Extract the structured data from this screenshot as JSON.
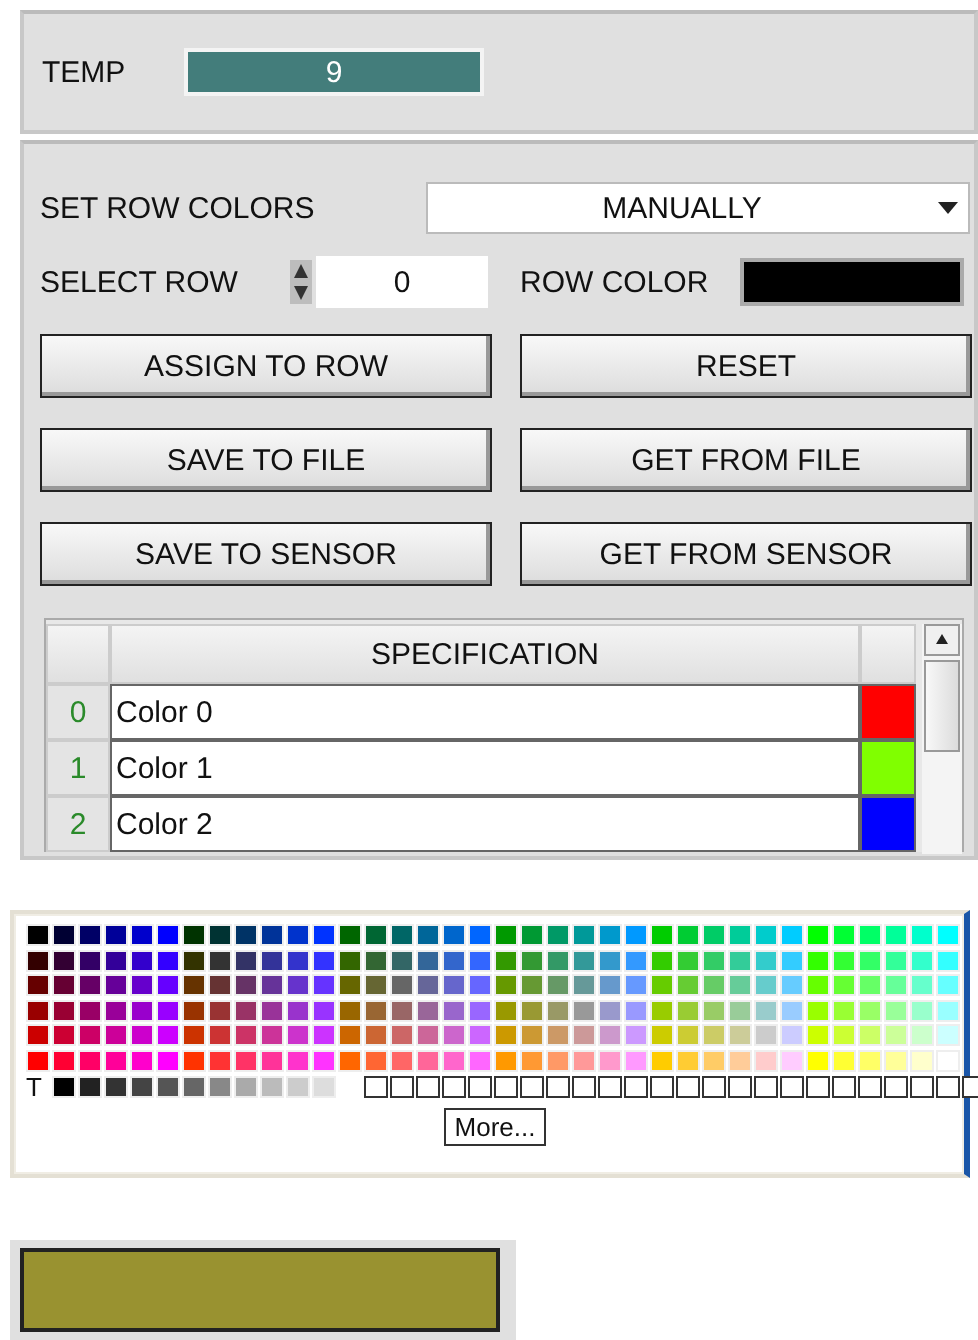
{
  "temp": {
    "label": "TEMP",
    "value": "9"
  },
  "row_colors": {
    "label": "SET ROW COLORS",
    "value": "MANUALLY"
  },
  "select_row": {
    "label": "SELECT ROW",
    "value": "0"
  },
  "row_color": {
    "label": "ROW COLOR",
    "color": "#000000"
  },
  "buttons": [
    "ASSIGN TO ROW",
    "RESET",
    "SAVE TO FILE",
    "GET FROM FILE",
    "SAVE TO SENSOR",
    "GET FROM SENSOR"
  ],
  "table": {
    "columns": [
      "SPECIFICATION"
    ],
    "rows": [
      {
        "index": "0",
        "name": "Color 0",
        "color": "#ff0000"
      },
      {
        "index": "1",
        "name": "Color 1",
        "color": "#80ff00"
      },
      {
        "index": "2",
        "name": "Color 2",
        "color": "#0000ff"
      }
    ]
  },
  "palette": {
    "transparent_label": "T",
    "more_button": "More..."
  },
  "selected_color": {
    "color": "#999230"
  }
}
